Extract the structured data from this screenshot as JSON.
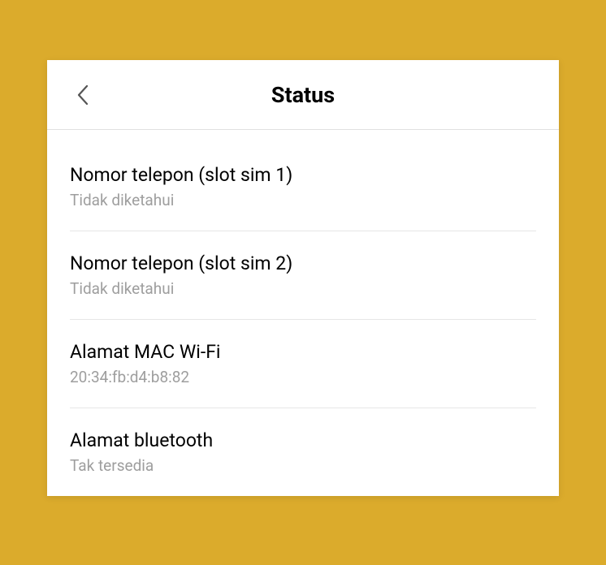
{
  "header": {
    "title": "Status"
  },
  "items": [
    {
      "label": "Nomor telepon (slot sim 1)",
      "value": "Tidak diketahui"
    },
    {
      "label": "Nomor telepon (slot sim 2)",
      "value": "Tidak diketahui"
    },
    {
      "label": "Alamat MAC Wi-Fi",
      "value": "20:34:fb:d4:b8:82"
    },
    {
      "label": "Alamat bluetooth",
      "value": "Tak tersedia"
    }
  ]
}
